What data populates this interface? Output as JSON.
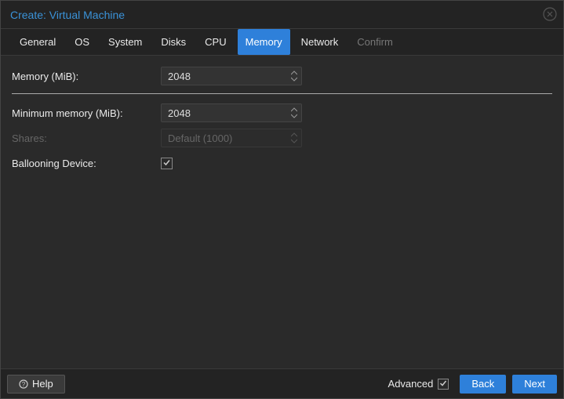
{
  "title": "Create: Virtual Machine",
  "tabs": [
    {
      "label": "General"
    },
    {
      "label": "OS"
    },
    {
      "label": "System"
    },
    {
      "label": "Disks"
    },
    {
      "label": "CPU"
    },
    {
      "label": "Memory",
      "active": true
    },
    {
      "label": "Network"
    },
    {
      "label": "Confirm",
      "disabled": true
    }
  ],
  "form": {
    "memory": {
      "label": "Memory (MiB):",
      "value": "2048"
    },
    "min_memory": {
      "label": "Minimum memory (MiB):",
      "value": "2048"
    },
    "shares": {
      "label": "Shares:",
      "value": "Default (1000)"
    },
    "ballooning": {
      "label": "Ballooning Device:",
      "checked": true
    }
  },
  "footer": {
    "help": "Help",
    "advanced": "Advanced",
    "advanced_checked": true,
    "back": "Back",
    "next": "Next"
  }
}
